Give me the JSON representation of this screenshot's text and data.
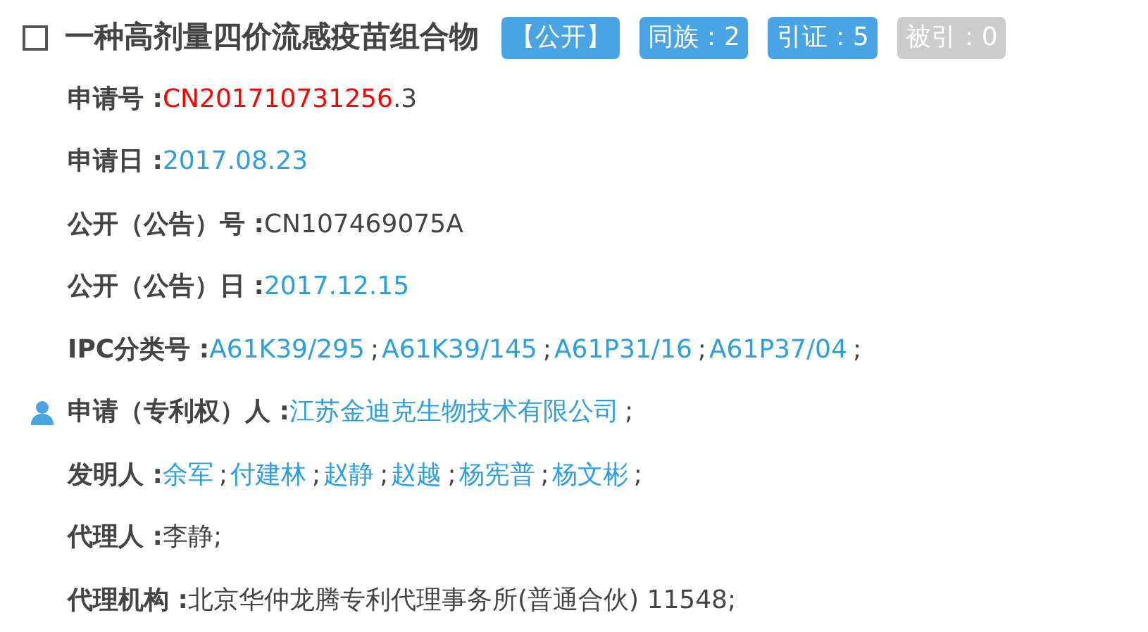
{
  "title": {
    "checked": false,
    "text": "一种高剂量四价流感疫苗组合物"
  },
  "badges": [
    {
      "text": "【公开】",
      "disabled": false
    },
    {
      "text": "同族：2",
      "disabled": false
    },
    {
      "text": "引证：5",
      "disabled": false
    },
    {
      "text": "被引：0",
      "disabled": true
    }
  ],
  "fields": [
    {
      "label": "申请号 :",
      "icon": false,
      "parts": [
        {
          "kind": "red",
          "text": "CN201710731256"
        },
        {
          "kind": "plain",
          "text": ".3"
        }
      ]
    },
    {
      "label": "申请日 :",
      "icon": false,
      "parts": [
        {
          "kind": "blue",
          "text": "2017.08.23"
        }
      ]
    },
    {
      "label": "公开（公告）号 :",
      "icon": false,
      "parts": [
        {
          "kind": "plain",
          "text": "CN107469075A"
        }
      ]
    },
    {
      "label": "公开（公告）日 :",
      "icon": false,
      "parts": [
        {
          "kind": "blue",
          "text": "2017.12.15"
        }
      ]
    },
    {
      "label": "IPC分类号 :",
      "icon": false,
      "parts": [
        {
          "kind": "link",
          "text": "A61K39/295"
        },
        {
          "kind": "plain",
          "text": ";"
        },
        {
          "kind": "link",
          "text": "A61K39/145"
        },
        {
          "kind": "plain",
          "text": ";"
        },
        {
          "kind": "link",
          "text": "A61P31/16"
        },
        {
          "kind": "plain",
          "text": ";"
        },
        {
          "kind": "link",
          "text": "A61P37/04"
        },
        {
          "kind": "plain",
          "text": ";"
        }
      ]
    },
    {
      "label": "申请（专利权）人 :",
      "icon": true,
      "parts": [
        {
          "kind": "link",
          "text": "江苏金迪克生物技术有限公司"
        },
        {
          "kind": "plain",
          "text": ";"
        }
      ]
    },
    {
      "label": "发明人 :",
      "icon": false,
      "parts": [
        {
          "kind": "link",
          "text": "余军"
        },
        {
          "kind": "plain",
          "text": ";"
        },
        {
          "kind": "link",
          "text": "付建林"
        },
        {
          "kind": "plain",
          "text": ";"
        },
        {
          "kind": "link",
          "text": "赵静"
        },
        {
          "kind": "plain",
          "text": ";"
        },
        {
          "kind": "link",
          "text": "赵越"
        },
        {
          "kind": "plain",
          "text": ";"
        },
        {
          "kind": "link",
          "text": "杨宪普"
        },
        {
          "kind": "plain",
          "text": ";"
        },
        {
          "kind": "link",
          "text": "杨文彬"
        },
        {
          "kind": "plain",
          "text": ";"
        }
      ]
    },
    {
      "label": "代理人 :",
      "icon": false,
      "parts": [
        {
          "kind": "plain",
          "text": "李静;"
        }
      ]
    },
    {
      "label": "代理机构 :",
      "icon": false,
      "parts": [
        {
          "kind": "plain",
          "text": "北京华仲龙腾专利代理事务所(普通合伙) 11548;"
        }
      ]
    }
  ]
}
